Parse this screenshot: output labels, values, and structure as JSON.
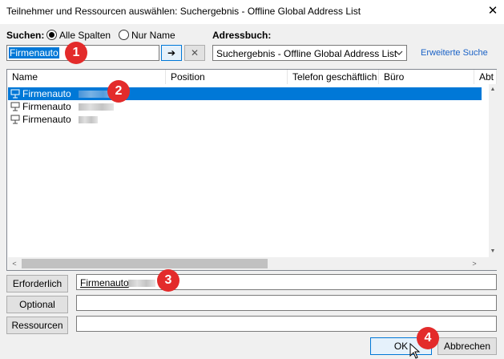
{
  "window": {
    "title": "Teilnehmer und Ressourcen auswählen: Suchergebnis - Offline Global Address List",
    "close_glyph": "✕"
  },
  "search": {
    "label": "Suchen:",
    "options": [
      {
        "label": "Alle Spalten",
        "checked": true
      },
      {
        "label": "Nur Name",
        "checked": false
      }
    ],
    "value": "Firmenauto",
    "go_glyph": "➔",
    "clear_glyph": "✕"
  },
  "addressbook": {
    "label": "Adressbuch:",
    "selected": "Suchergebnis - Offline Global Address List",
    "advanced_link": "Erweiterte Suche"
  },
  "list": {
    "columns": [
      "Name",
      "Position",
      "Telefon geschäftlich",
      "Büro",
      "Abt"
    ],
    "rows": [
      {
        "name": "Firmenauto",
        "selected": true
      },
      {
        "name": "Firmenauto",
        "selected": false
      },
      {
        "name": "Firmenauto",
        "selected": false
      }
    ],
    "scroll_up": "▲",
    "scroll_down": "▼",
    "scroll_left": "<",
    "scroll_right": ">"
  },
  "recipients": {
    "required_button": "Erforderlich",
    "required_value": "Firmenauto",
    "optional_button": "Optional",
    "optional_value": "",
    "resources_button": "Ressourcen",
    "resources_value": ""
  },
  "footer": {
    "ok": "OK",
    "cancel": "Abbrechen"
  },
  "annotations": [
    "1",
    "2",
    "3",
    "4"
  ],
  "colors": {
    "selection": "#0078d7",
    "callout": "#e32b2b",
    "link": "#1a62c6"
  }
}
